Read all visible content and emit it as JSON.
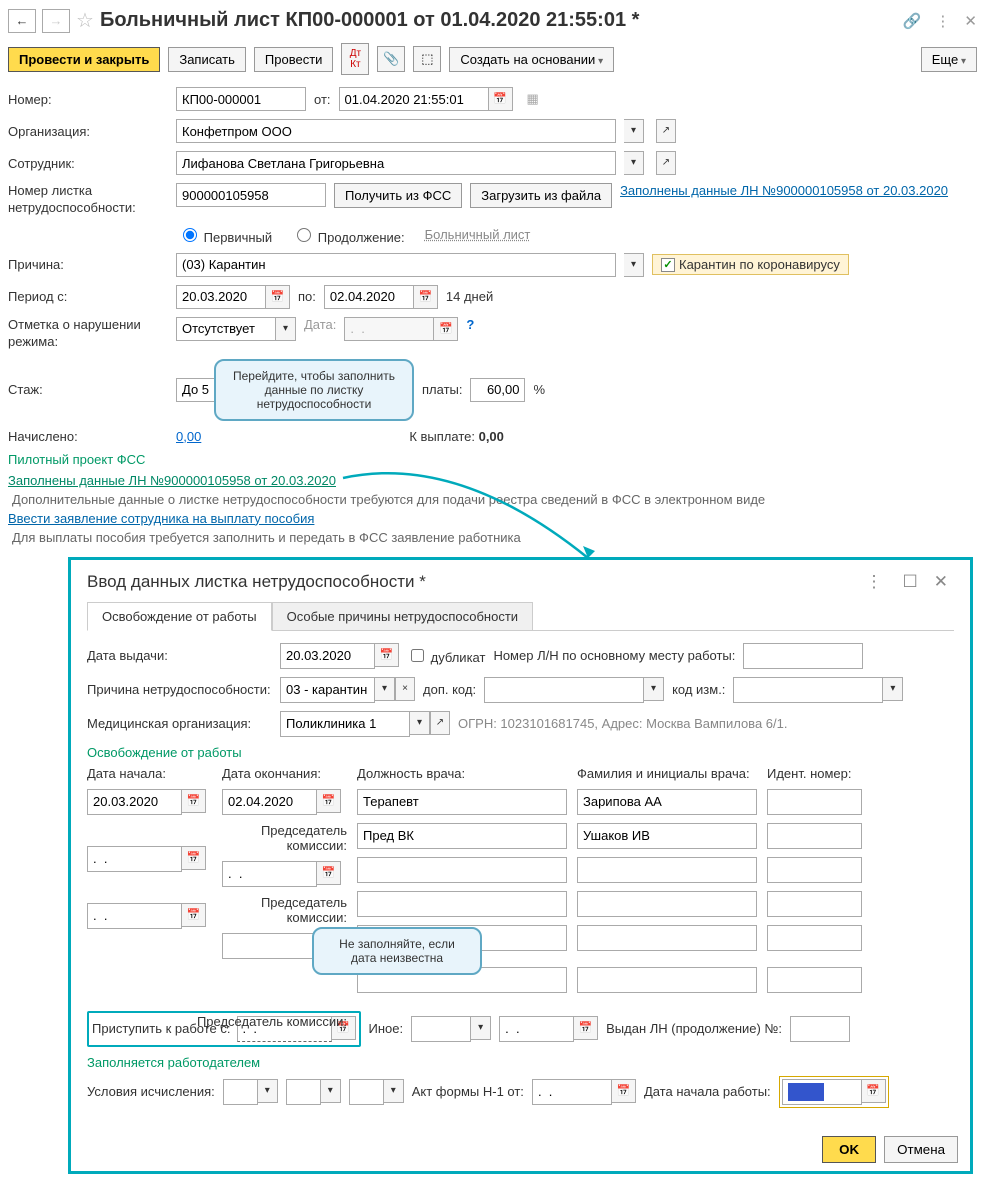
{
  "title": "Больничный лист КП00-000001 от 01.04.2020 21:55:01 *",
  "toolbar": {
    "post_close": "Провести и закрыть",
    "save": "Записать",
    "post": "Провести",
    "create_based": "Создать на основании",
    "more": "Еще"
  },
  "labels": {
    "number": "Номер:",
    "from": "от:",
    "org": "Организация:",
    "employee": "Сотрудник:",
    "ln_number": "Номер листка нетрудоспособности:",
    "get_fss": "Получить из ФСС",
    "load_file": "Загрузить из файла",
    "primary": "Первичный",
    "continuation": "Продолжение:",
    "cont_link": "Больничный лист",
    "reason": "Причина:",
    "covid": "Карантин по коронавирусу",
    "period_from": "Период с:",
    "period_to": "по:",
    "days": "14 дней",
    "violation": "Отметка о нарушении режима:",
    "violation_date": "Дата:",
    "seniority": "Стаж:",
    "pay_label": "платы:",
    "pct": "%",
    "accrued": "Начислено:",
    "to_pay": "К выплате:",
    "pilot": "Пилотный проект ФСС",
    "filled_link": "Заполнены данные ЛН №900000105958 от 20.03.2020",
    "extra_info": "Дополнительные данные о листке нетрудоспособности требуются для подачи реестра сведений в ФСС в электронном виде",
    "enter_app": "Ввести заявление сотрудника на выплату пособия",
    "app_info": "Для выплаты пособия требуется заполнить и передать в ФСС заявление работника"
  },
  "values": {
    "number": "КП00-000001",
    "date": "01.04.2020 21:55:01",
    "org": "Конфетпром ООО",
    "employee": "Лифанова Светлана Григорьевна",
    "ln_number": "900000105958",
    "reason": "(03) Карантин",
    "period_from": "20.03.2020",
    "period_to": "02.04.2020",
    "violation": "Отсутствует",
    "violation_date": ".  .",
    "seniority": "До 5",
    "pay_pct": "60,00",
    "accrued": "0,00",
    "to_pay": "0,00"
  },
  "tooltip1": "Перейдите, чтобы заполнить данные по листку нетрудоспособности",
  "tooltip2": "Не заполняйте, если дата неизвестна",
  "dialog": {
    "title": "Ввод данных листка нетрудоспособности *",
    "tabs": {
      "t1": "Освобождение от работы",
      "t2": "Особые причины нетрудоспособности"
    },
    "labels": {
      "issue_date": "Дата выдачи:",
      "duplicate": "дубликат",
      "ln_main": "Номер Л/Н по основному месту работы:",
      "reason": "Причина нетрудоспособности:",
      "add_code": "доп. код:",
      "change_code": "код изм.:",
      "med_org": "Медицинская организация:",
      "ogrn_info": "ОГРН: 1023101681745, Адрес: Москва Вампилова 6/1.",
      "section1": "Освобождение от работы",
      "start_date": "Дата начала:",
      "end_date": "Дата окончания:",
      "doctor_pos": "Должность врача:",
      "doctor_name": "Фамилия и инициалы врача:",
      "ident": "Идент. номер:",
      "committee": "Председатель комиссии:",
      "return_work": "Приступить к работе с:",
      "other": "Иное:",
      "issued_ln": "Выдан ЛН (продолжение) №:",
      "section2": "Заполняется работодателем",
      "calc_cond": "Условия исчисления:",
      "act_h1": "Акт формы Н-1 от:",
      "work_start": "Дата начала работы:"
    },
    "values": {
      "issue_date": "20.03.2020",
      "reason": "03 - карантин",
      "med_org": "Поликлиника 1",
      "start1": "20.03.2020",
      "end1": "02.04.2020",
      "pos1": "Терапевт",
      "name1": "Зарипова АА",
      "comm_pos1": "Пред ВК",
      "comm_name1": "Ушаков ИВ",
      "empty_date": ".  .",
      "return_date": ".  .    ",
      "act_date": ".  .    "
    },
    "buttons": {
      "ok": "OK",
      "cancel": "Отмена"
    }
  }
}
